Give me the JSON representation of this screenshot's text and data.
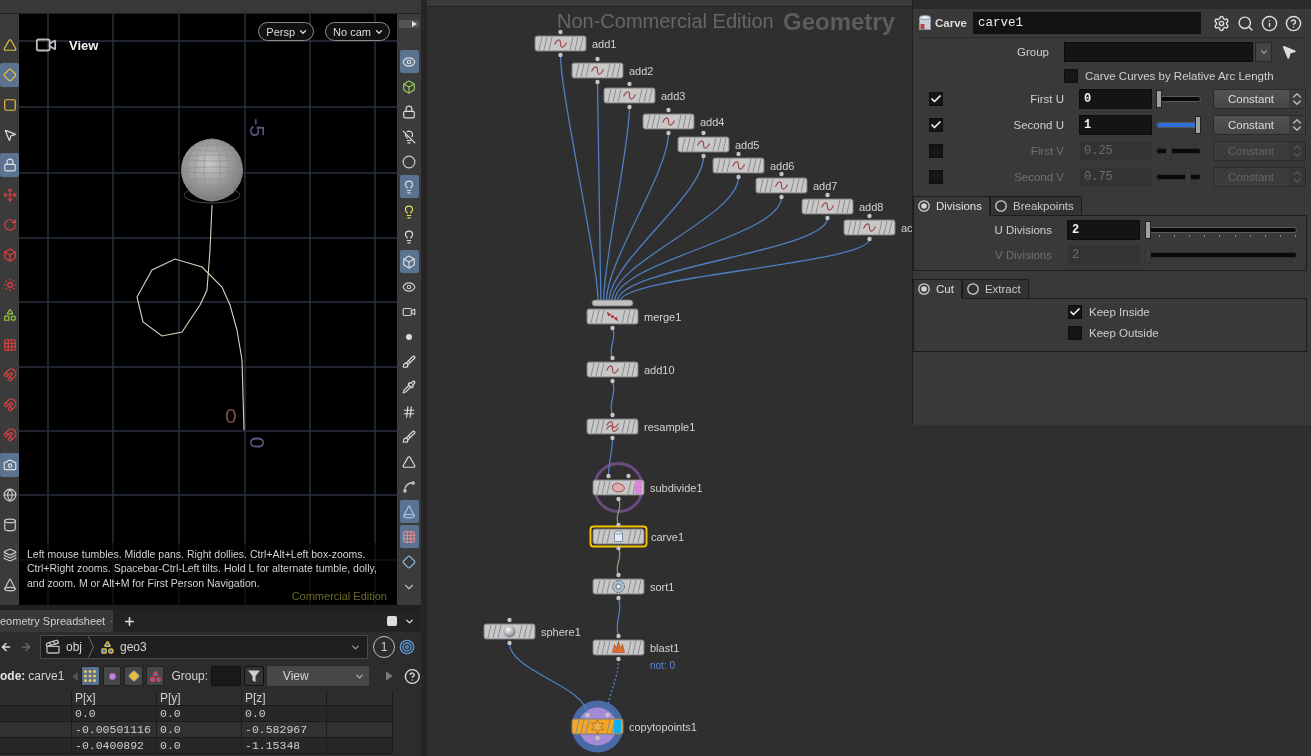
{
  "viewport": {
    "title": "View",
    "camera_buttons": [
      {
        "label": "Persp"
      },
      {
        "label": "No cam"
      }
    ],
    "axis_labels": [
      {
        "text": "-5",
        "kind": "rotated",
        "color": "#565a86"
      },
      {
        "text": "0",
        "kind": "upright",
        "color": "#7e4c4c"
      },
      {
        "text": "0",
        "kind": "rotated",
        "color": "#565a86"
      }
    ],
    "help": "Left mouse tumbles. Middle pans. Right dollies. Ctrl+Alt+Left box-zooms. Ctrl+Right zooms. Spacebar-Ctrl-Left tilts. Hold L for alternate tumble, dolly, and zoom. M or Alt+M for First Person Navigation.",
    "watermark": "Commercial Edition"
  },
  "left_shelf": [
    {
      "on": false
    },
    {
      "on": true
    },
    {
      "on": false
    },
    {
      "on": false
    },
    {
      "on": true
    },
    {
      "on": false
    },
    {
      "on": false
    },
    {
      "on": false
    },
    {
      "on": false
    },
    {
      "on": false
    },
    {
      "on": false
    },
    {
      "on": false
    },
    {
      "on": false
    },
    {
      "on": false
    },
    {
      "on": true
    },
    {
      "on": false
    },
    {
      "on": false
    },
    {
      "on": false
    },
    {
      "on": false
    }
  ],
  "viewport_tools": [
    {
      "on": true
    },
    {
      "on": false
    },
    {
      "on": false
    },
    {
      "on": false
    },
    {
      "on": false
    },
    {
      "on": true
    },
    {
      "on": false
    },
    {
      "on": false
    },
    {
      "on": true
    },
    {
      "on": false
    },
    {
      "on": false
    },
    {
      "on": false
    },
    {
      "on": false
    },
    {
      "on": false
    },
    {
      "on": false
    },
    {
      "on": false
    },
    {
      "on": false
    },
    {
      "on": false
    },
    {
      "on": true
    },
    {
      "on": true
    },
    {
      "on": false
    },
    {
      "on": false
    }
  ],
  "spreadsheet": {
    "tab": "eometry Spreadsheet",
    "path": [
      "obj",
      "geo3"
    ],
    "pane_number": "1",
    "node_prefix": "ode:",
    "node_name": "carve1",
    "attribute_classes": [
      {
        "selected": true
      },
      {
        "selected": false
      },
      {
        "selected": false
      },
      {
        "selected": false
      }
    ],
    "group_label": "Group:",
    "view": "View",
    "columns": [
      "P[x]",
      "P[y]",
      "P[z]"
    ],
    "rows": [
      [
        "0.0",
        "0.0",
        "0.0"
      ],
      [
        "-0.00501116",
        "0.0",
        "-0.582967"
      ],
      [
        "-0.0400892",
        "0.0",
        "-1.15348"
      ]
    ]
  },
  "network": {
    "watermark": "Non-Commercial Edition",
    "context": "Geometry",
    "nodes": [
      {
        "label": "add1",
        "kind": "add",
        "selected": false,
        "color": "#c8c8c8",
        "template_flag": false,
        "display_flag": false
      },
      {
        "label": "add2",
        "kind": "add",
        "selected": false,
        "color": "#c8c8c8",
        "template_flag": false,
        "display_flag": false
      },
      {
        "label": "add3",
        "kind": "add",
        "selected": false,
        "color": "#c8c8c8",
        "template_flag": false,
        "display_flag": false
      },
      {
        "label": "add4",
        "kind": "add",
        "selected": false,
        "color": "#c8c8c8",
        "template_flag": false,
        "display_flag": false
      },
      {
        "label": "add5",
        "kind": "add",
        "selected": false,
        "color": "#c8c8c8",
        "template_flag": false,
        "display_flag": false
      },
      {
        "label": "add6",
        "kind": "add",
        "selected": false,
        "color": "#c8c8c8",
        "template_flag": false,
        "display_flag": false
      },
      {
        "label": "add7",
        "kind": "add",
        "selected": false,
        "color": "#c8c8c8",
        "template_flag": false,
        "display_flag": false
      },
      {
        "label": "add8",
        "kind": "add",
        "selected": false,
        "color": "#c8c8c8",
        "template_flag": false,
        "display_flag": false
      },
      {
        "label": "ac",
        "kind": "add",
        "selected": false,
        "color": "#c8c8c8",
        "template_flag": false,
        "display_flag": false
      },
      {
        "label": "merge1",
        "kind": "merge",
        "selected": false,
        "color": "#c8c8c8",
        "template_flag": false,
        "display_flag": false
      },
      {
        "label": "add10",
        "kind": "add",
        "selected": false,
        "color": "#c8c8c8",
        "template_flag": false,
        "display_flag": false
      },
      {
        "label": "resample1",
        "kind": "resample",
        "selected": false,
        "color": "#c8c8c8",
        "template_flag": false,
        "display_flag": false
      },
      {
        "label": "subdivide1",
        "kind": "subdivide",
        "selected": false,
        "color": "#c8c8c8",
        "template_flag": true,
        "display_flag": false,
        "ring": {
          "kind": "outline",
          "color": "#6b4a7e"
        }
      },
      {
        "label": "carve1",
        "kind": "carve",
        "selected": true,
        "color": "#c8c8c8",
        "template_flag": false,
        "display_flag": false
      },
      {
        "label": "sort1",
        "kind": "sort",
        "selected": false,
        "color": "#c8c8c8",
        "template_flag": false,
        "display_flag": false
      },
      {
        "label": "sphere1",
        "kind": "sphere",
        "selected": false,
        "color": "#c8c8c8",
        "template_flag": false,
        "display_flag": false
      },
      {
        "label": "blast1",
        "kind": "blast",
        "selected": false,
        "color": "#c8c8c8",
        "template_flag": false,
        "display_flag": false,
        "note": "not: 0"
      },
      {
        "label": "copytopoints1",
        "kind": "copytopoints",
        "selected": false,
        "color": "#f5a623",
        "template_flag": false,
        "display_flag": true,
        "ring": {
          "kind": "disc",
          "color": "#4a6aa6"
        }
      }
    ],
    "wires": [
      {
        "kind": "solid",
        "color": "#4f7fc0"
      },
      {
        "kind": "solid",
        "color": "#4f7fc0"
      },
      {
        "kind": "solid",
        "color": "#4f7fc0"
      },
      {
        "kind": "solid",
        "color": "#4f7fc0"
      },
      {
        "kind": "solid",
        "color": "#4f7fc0"
      },
      {
        "kind": "solid",
        "color": "#4f7fc0"
      },
      {
        "kind": "solid",
        "color": "#4f7fc0"
      },
      {
        "kind": "solid",
        "color": "#4f7fc0"
      },
      {
        "kind": "solid",
        "color": "#4f7fc0"
      },
      {
        "kind": "solid",
        "color": "#4f7fc0"
      },
      {
        "kind": "solid",
        "color": "#4f7fc0"
      },
      {
        "kind": "solid",
        "color": "#4f7fc0"
      },
      {
        "kind": "solid",
        "color": "#8e9a6c"
      },
      {
        "kind": "solid",
        "color": "#8e9a6c"
      },
      {
        "kind": "solid",
        "color": "#4f7fc0"
      },
      {
        "kind": "dotted",
        "color": "#4f7fc0"
      },
      {
        "kind": "solid",
        "color": "#4f7fc0"
      }
    ]
  },
  "parameters": {
    "node_type": "Carve",
    "node_name": "carve1",
    "group_label": "Group",
    "arc_length": {
      "label": "Carve Curves by Relative Arc Length",
      "checked": false
    },
    "uv_rows": [
      {
        "label": "First U",
        "checked": true,
        "disabled": false,
        "value": "0",
        "level": 0,
        "mode": "Constant"
      },
      {
        "label": "Second U",
        "checked": true,
        "disabled": false,
        "value": "1",
        "level": 1,
        "mode": "Constant"
      },
      {
        "label": "First V",
        "checked": false,
        "disabled": true,
        "value": "0.25",
        "level": 0.25,
        "mode": "Constant"
      },
      {
        "label": "Second V",
        "checked": false,
        "disabled": true,
        "value": "0.75",
        "level": 0.75,
        "mode": "Constant"
      }
    ],
    "division_tabs": [
      {
        "label": "Divisions",
        "selected": true
      },
      {
        "label": "Breakpoints",
        "selected": false
      }
    ],
    "divisions": [
      {
        "label": "U Divisions",
        "value": "2",
        "level": 0,
        "disabled": false
      },
      {
        "label": "V Divisions",
        "value": "2",
        "level": 0,
        "disabled": true
      }
    ],
    "cut_tabs": [
      {
        "label": "Cut",
        "selected": true
      },
      {
        "label": "Extract",
        "selected": false
      }
    ],
    "keep_options": [
      {
        "label": "Keep Inside",
        "checked": true
      },
      {
        "label": "Keep Outside",
        "checked": false
      }
    ]
  }
}
